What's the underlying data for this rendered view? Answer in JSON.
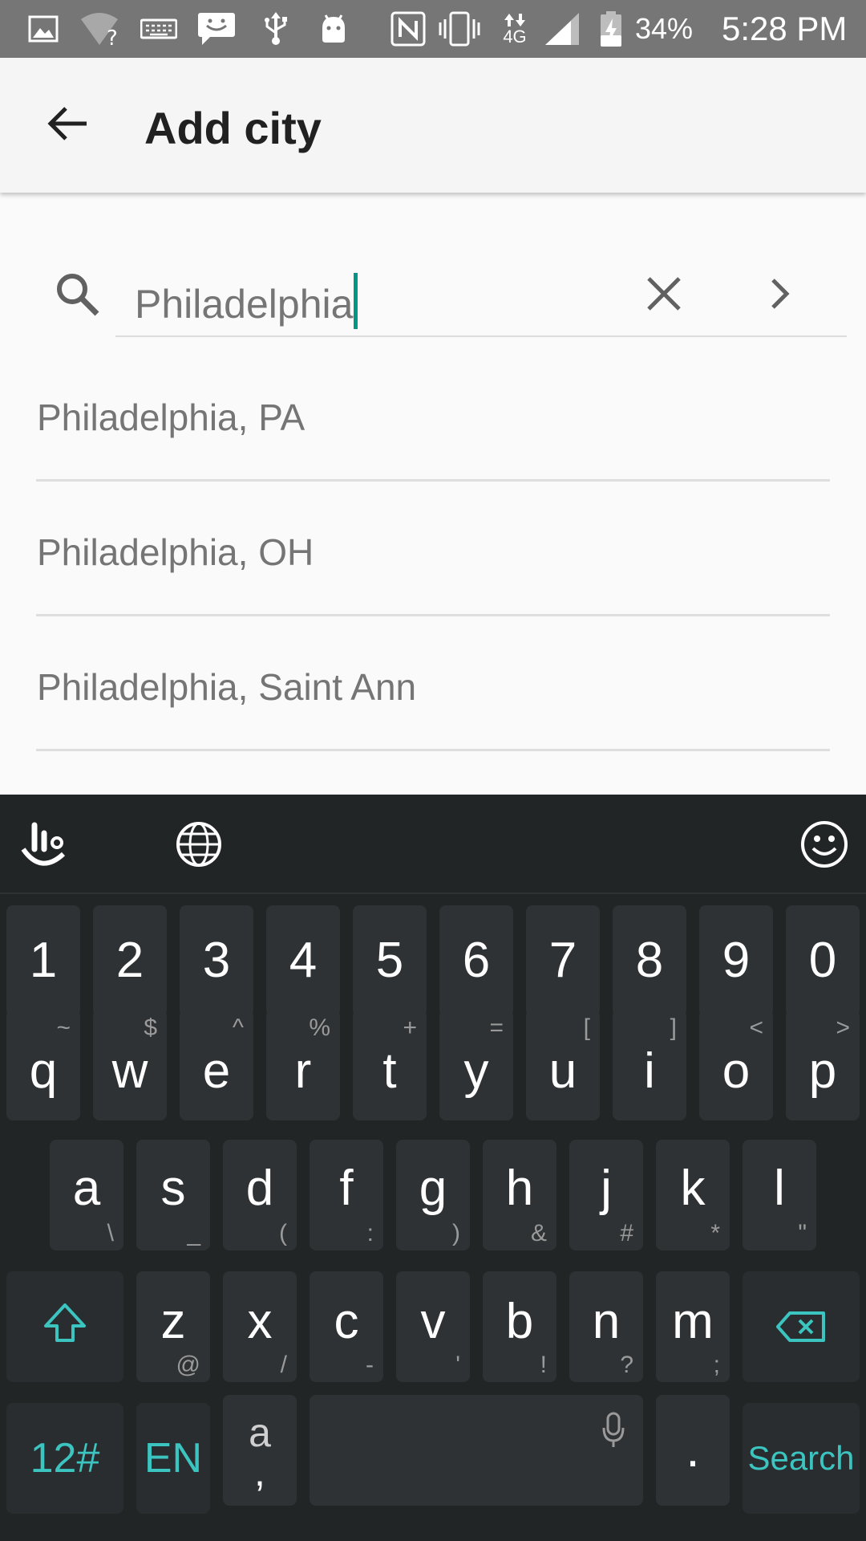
{
  "status_bar": {
    "battery": "34%",
    "time": "5:28 PM",
    "network": "4G",
    "icons": [
      "image-icon",
      "wifi-unknown-icon",
      "keyboard-icon",
      "message-icon",
      "usb-icon",
      "android-icon",
      "nfc-icon",
      "vibrate-icon",
      "data-arrows-icon",
      "signal-icon",
      "battery-icon"
    ]
  },
  "app_bar": {
    "title": "Add city",
    "back_icon": "arrow-back-icon"
  },
  "search": {
    "value": "Philadelphia",
    "search_icon": "search-icon",
    "clear_icon": "close-icon",
    "go_icon": "chevron-right-icon"
  },
  "results": [
    {
      "label": "Philadelphia, PA"
    },
    {
      "label": "Philadelphia, OH"
    },
    {
      "label": "Philadelphia, Saint Ann"
    }
  ],
  "keyboard": {
    "toolbar": [
      "swype-logo-icon",
      "globe-icon",
      "emoji-icon"
    ],
    "rows": [
      [
        {
          "main": "1"
        },
        {
          "main": "2"
        },
        {
          "main": "3"
        },
        {
          "main": "4"
        },
        {
          "main": "5"
        },
        {
          "main": "6"
        },
        {
          "main": "7"
        },
        {
          "main": "8"
        },
        {
          "main": "9"
        },
        {
          "main": "0"
        }
      ],
      [
        {
          "main": "q",
          "sub": "~"
        },
        {
          "main": "w",
          "sub": "$"
        },
        {
          "main": "e",
          "sub": "^"
        },
        {
          "main": "r",
          "sub": "%"
        },
        {
          "main": "t",
          "sub": "+"
        },
        {
          "main": "y",
          "sub": "="
        },
        {
          "main": "u",
          "sub": "["
        },
        {
          "main": "i",
          "sub": "]"
        },
        {
          "main": "o",
          "sub": "<"
        },
        {
          "main": "p",
          "sub": ">"
        }
      ],
      [
        {
          "main": "a",
          "sub": "\\"
        },
        {
          "main": "s",
          "sub": "_"
        },
        {
          "main": "d",
          "sub": "("
        },
        {
          "main": "f",
          "sub": ":"
        },
        {
          "main": "g",
          "sub": ")"
        },
        {
          "main": "h",
          "sub": "&"
        },
        {
          "main": "j",
          "sub": "#"
        },
        {
          "main": "k",
          "sub": "*"
        },
        {
          "main": "l",
          "sub": "\""
        }
      ],
      [
        {
          "main": "z",
          "sub": "@"
        },
        {
          "main": "x",
          "sub": "/"
        },
        {
          "main": "c",
          "sub": "-"
        },
        {
          "main": "v",
          "sub": "'"
        },
        {
          "main": "b",
          "sub": "!"
        },
        {
          "main": "n",
          "sub": "?"
        },
        {
          "main": "m",
          "sub": ";"
        }
      ]
    ],
    "shift_icon": "shift-arrow-icon",
    "backspace_icon": "backspace-icon",
    "symbols_label": "12#",
    "language_label": "EN",
    "alt_key_top": "a",
    "alt_key_bottom": ",",
    "mic_icon": "mic-icon",
    "period_label": ".",
    "search_label": "Search",
    "accent_color": "#3bc4c0"
  }
}
